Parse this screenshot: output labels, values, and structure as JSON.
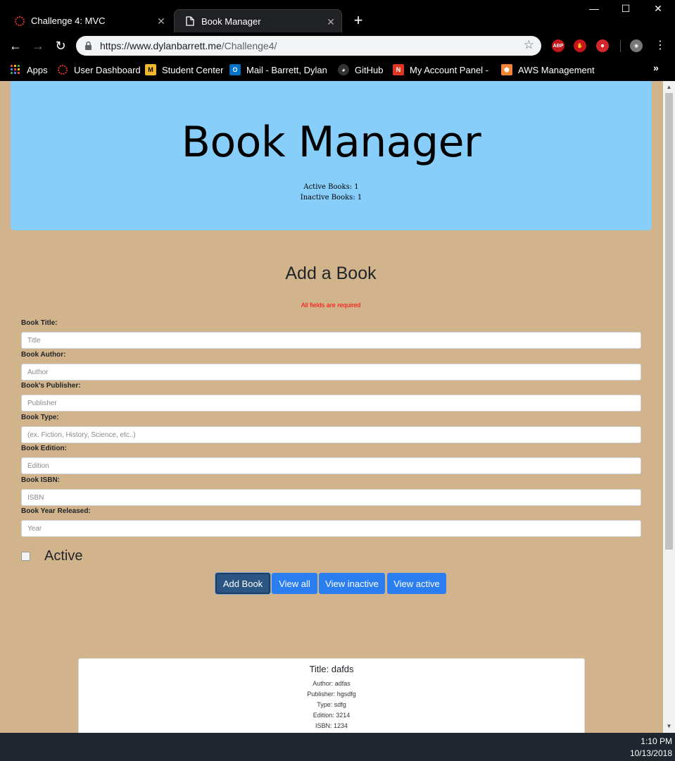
{
  "browser": {
    "tabs": [
      {
        "label": "Challenge 4: MVC",
        "active": false
      },
      {
        "label": "Book Manager",
        "active": true
      }
    ],
    "url_host": "https://www.dylanbarrett.me",
    "url_path": "/Challenge4/",
    "extensions": [
      "ABP",
      "shield",
      "ghost",
      "avatar"
    ],
    "bookmarks": [
      {
        "label": "Apps",
        "icon": "apps-grid-icon"
      },
      {
        "label": "User Dashboard",
        "icon": "ring-icon"
      },
      {
        "label": "Student Center",
        "icon": "tiger-icon"
      },
      {
        "label": "Mail - Barrett, Dylan (",
        "icon": "outlook-icon"
      },
      {
        "label": "GitHub",
        "icon": "github-icon"
      },
      {
        "label": "My Account Panel - N",
        "icon": "namecheap-icon"
      },
      {
        "label": "AWS Management Co",
        "icon": "aws-icon"
      }
    ]
  },
  "page": {
    "header": {
      "title": "Book Manager",
      "active_count_text": "Active Books: 1",
      "inactive_count_text": "Inactive Books: 1"
    },
    "form": {
      "title": "Add a Book",
      "required_note": "All fields are required",
      "fields": [
        {
          "label": "Book Title:",
          "placeholder": "Title"
        },
        {
          "label": "Book Author:",
          "placeholder": "Author"
        },
        {
          "label": "Book's Publisher:",
          "placeholder": "Publisher"
        },
        {
          "label": "Book Type:",
          "placeholder": "(ex. Fiction, History, Science, etc..)"
        },
        {
          "label": "Book Edition:",
          "placeholder": "Edition"
        },
        {
          "label": "Book ISBN:",
          "placeholder": "ISBN"
        },
        {
          "label": "Book Year Released:",
          "placeholder": "Year"
        }
      ],
      "active_label": "Active",
      "active_checked": false,
      "buttons": {
        "add": "Add Book",
        "view_all": "View all",
        "view_inactive": "View inactive",
        "view_active": "View active"
      }
    },
    "book_card": {
      "title": "Title: dafds",
      "author": "Author: adfas",
      "publisher": "Publisher: hgsdfg",
      "type": "Type: sdfg",
      "edition": "Edition: 3214",
      "isbn": "ISBN: 1234"
    }
  },
  "taskbar": {
    "time": "1:10 PM",
    "date": "10/13/2018"
  },
  "colors": {
    "page_bg": "#d2b48c",
    "header_bg": "#87cefa",
    "button_blue": "#2a7ef0",
    "button_active": "#2b5582",
    "required_red": "#ff0000"
  }
}
